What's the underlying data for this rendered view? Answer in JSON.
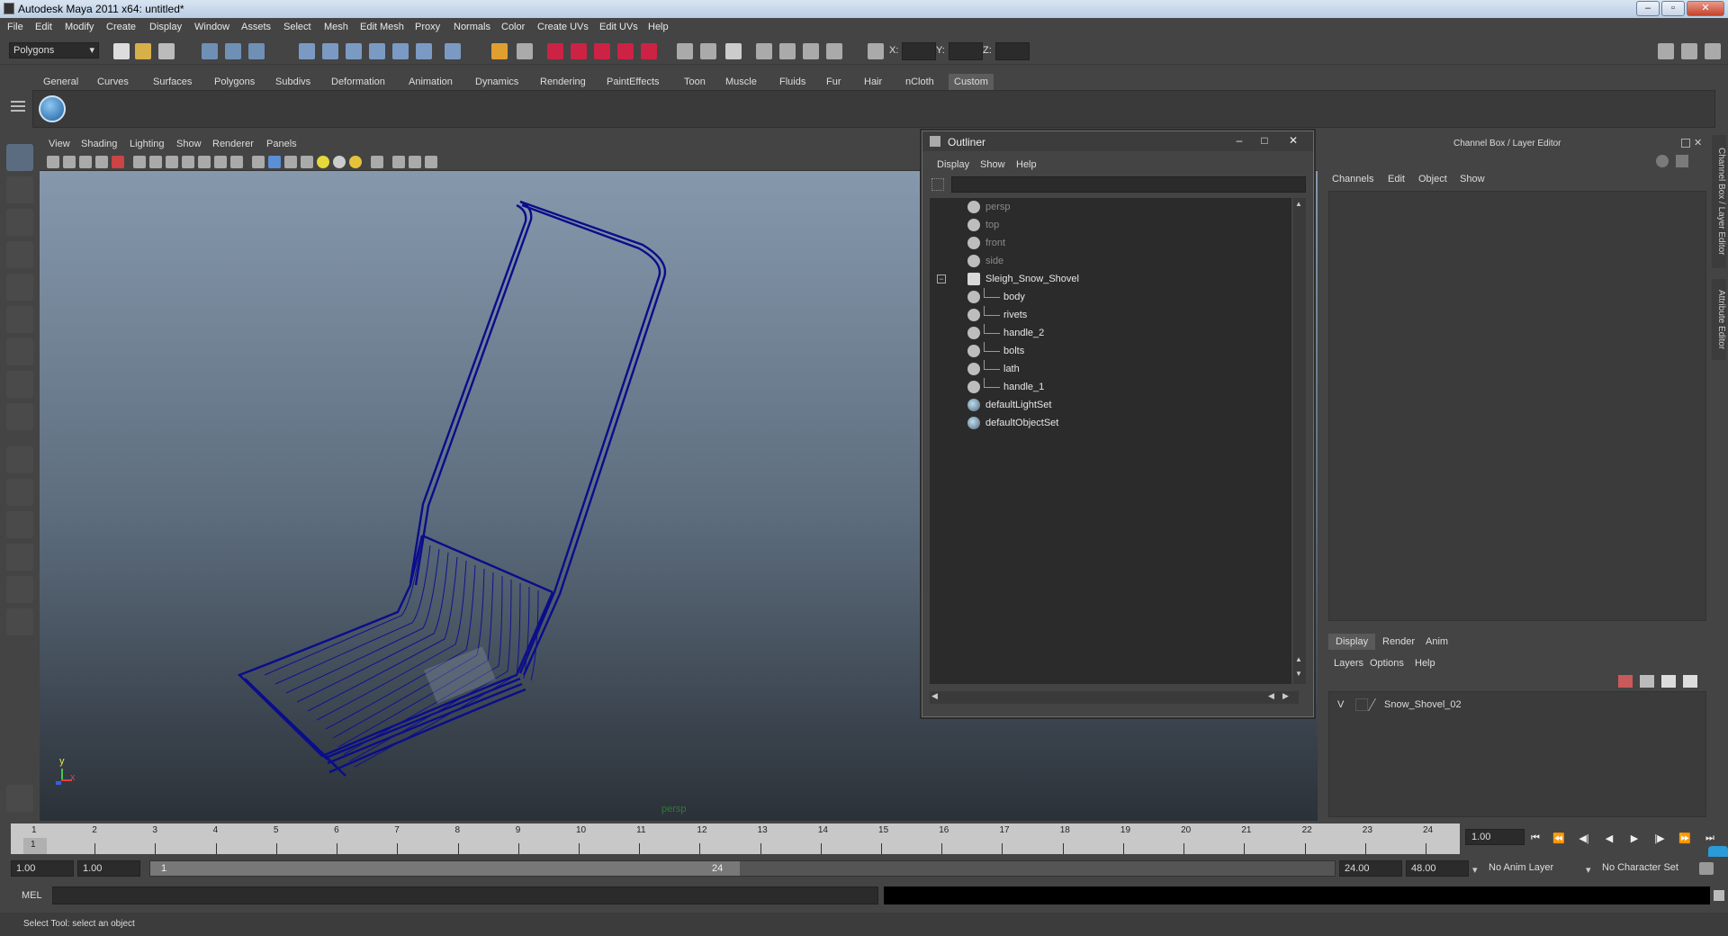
{
  "window": {
    "title": "Autodesk Maya 2011 x64: untitled*"
  },
  "menubar": [
    "File",
    "Edit",
    "Modify",
    "Create",
    "Display",
    "Window",
    "Assets",
    "Select",
    "Mesh",
    "Edit Mesh",
    "Proxy",
    "Normals",
    "Color",
    "Create UVs",
    "Edit UVs",
    "Help"
  ],
  "statusline": {
    "mode": "Polygons",
    "x_label": "X:",
    "y_label": "Y:",
    "z_label": "Z:"
  },
  "shelf": {
    "tabs": [
      "General",
      "Curves",
      "Surfaces",
      "Polygons",
      "Subdivs",
      "Deformation",
      "Animation",
      "Dynamics",
      "Rendering",
      "PaintEffects",
      "Toon",
      "Muscle",
      "Fluids",
      "Fur",
      "Hair",
      "nCloth",
      "Custom"
    ],
    "active_tab": "Custom"
  },
  "viewport": {
    "menus": [
      "View",
      "Shading",
      "Lighting",
      "Show",
      "Renderer",
      "Panels"
    ],
    "camera_label": "persp",
    "axis_y": "y",
    "axis_x": "x",
    "wire_color": "#0a0d8a"
  },
  "outliner": {
    "title": "Outliner",
    "menus": [
      "Display",
      "Show",
      "Help"
    ],
    "items": [
      {
        "label": "persp",
        "dim": true,
        "indent": 0,
        "icon": "camera-icon"
      },
      {
        "label": "top",
        "dim": true,
        "indent": 0,
        "icon": "camera-icon"
      },
      {
        "label": "front",
        "dim": true,
        "indent": 0,
        "icon": "camera-icon"
      },
      {
        "label": "side",
        "dim": true,
        "indent": 0,
        "icon": "camera-icon"
      },
      {
        "label": "Sleigh_Snow_Shovel",
        "dim": false,
        "indent": 0,
        "icon": "group-icon",
        "expanded": true
      },
      {
        "label": "body",
        "dim": false,
        "indent": 1,
        "icon": "mesh-icon"
      },
      {
        "label": "rivets",
        "dim": false,
        "indent": 1,
        "icon": "mesh-icon"
      },
      {
        "label": "handle_2",
        "dim": false,
        "indent": 1,
        "icon": "mesh-icon"
      },
      {
        "label": "bolts",
        "dim": false,
        "indent": 1,
        "icon": "mesh-icon"
      },
      {
        "label": "lath",
        "dim": false,
        "indent": 1,
        "icon": "mesh-icon"
      },
      {
        "label": "handle_1",
        "dim": false,
        "indent": 1,
        "icon": "mesh-icon"
      },
      {
        "label": "defaultLightSet",
        "dim": false,
        "indent": 0,
        "icon": "set-icon"
      },
      {
        "label": "defaultObjectSet",
        "dim": false,
        "indent": 0,
        "icon": "set-icon"
      }
    ]
  },
  "channelbox": {
    "title": "Channel Box / Layer Editor",
    "menus": [
      "Channels",
      "Edit",
      "Object",
      "Show"
    ],
    "layer_tabs": [
      "Display",
      "Render",
      "Anim"
    ],
    "layer_menus": [
      "Layers",
      "Options",
      "Help"
    ],
    "layer": {
      "visible": "V",
      "name": "Snow_Shovel_02"
    }
  },
  "side_tabs": [
    "Channel Box / Layer Editor",
    "Attribute Editor"
  ],
  "timeline": {
    "ticks": [
      "1",
      "2",
      "3",
      "4",
      "5",
      "6",
      "7",
      "8",
      "9",
      "10",
      "11",
      "12",
      "13",
      "14",
      "15",
      "16",
      "17",
      "18",
      "19",
      "20",
      "21",
      "22",
      "23",
      "24"
    ],
    "current_frame_marker": "1",
    "current_frame": "1.00"
  },
  "range": {
    "start": "1.00",
    "playback_start": "1.00",
    "thumb_start": "1",
    "thumb_end": "24",
    "playback_end": "24.00",
    "end": "48.00",
    "anim_layer": "No Anim Layer",
    "char_set": "No Character Set"
  },
  "cmdline": {
    "label": "MEL"
  },
  "helpline": "Select Tool: select an object"
}
